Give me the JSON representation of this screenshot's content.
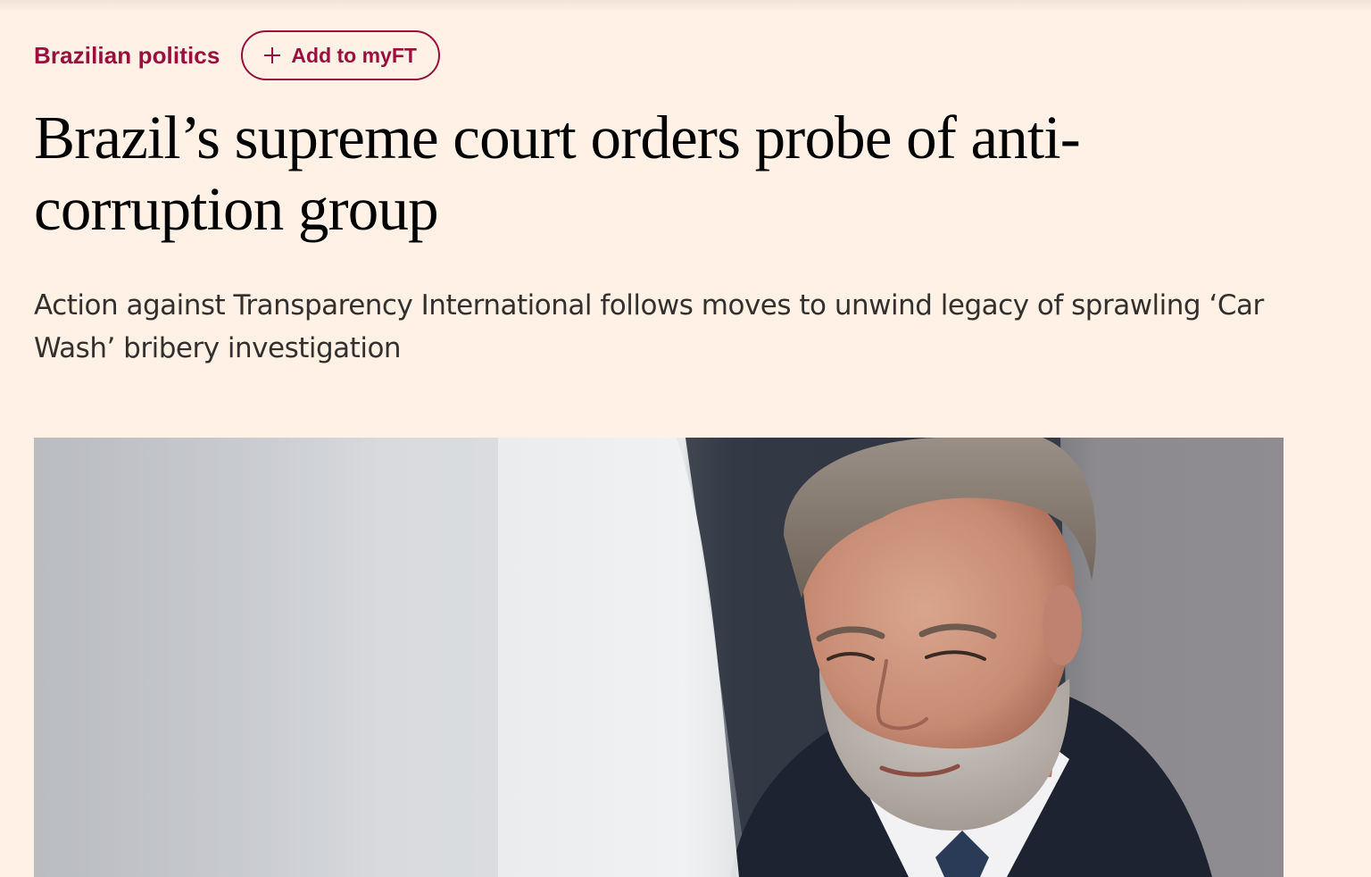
{
  "article": {
    "topic": "Brazilian politics",
    "add_to_myft_label": "Add to myFT",
    "headline": "Brazil’s supreme court orders probe of anti-corruption group",
    "standfirst": "Action against Transparency International follows moves to unwind legacy of sprawling ‘Car Wash’ bribery investigation"
  },
  "colors": {
    "page_background": "#FFF1E5",
    "accent": "#990F3D",
    "headline": "#000000",
    "standfirst": "#33302E"
  },
  "icons": {
    "add": "plus-icon"
  }
}
